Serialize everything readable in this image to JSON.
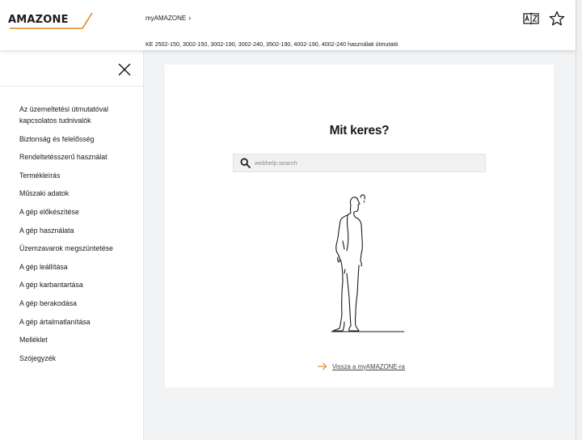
{
  "header": {
    "logo_text": "AMAZONE",
    "breadcrumb": "myAMAZONE",
    "breadcrumb_separator": "›",
    "subtitle": "KE 2502-150, 3002-150, 3002-190, 3002-240, 3502-190, 4002-190, 4002-240 használati útmutató",
    "icons": [
      "az-dictionary-icon",
      "star-icon"
    ]
  },
  "sidebar": {
    "close_icon": "close-icon",
    "items": [
      {
        "label": "Az üzemeltetési útmutatóval kapcsolatos tudnivalók"
      },
      {
        "label": "Biztonság és felelősség"
      },
      {
        "label": "Rendeltetésszerű használat"
      },
      {
        "label": "Termékleírás"
      },
      {
        "label": "Műszaki adatok"
      },
      {
        "label": "A gép előkészítése"
      },
      {
        "label": "A gép használata"
      },
      {
        "label": "Üzemzavarok megszüntetése"
      },
      {
        "label": "A gép leállítása"
      },
      {
        "label": "A gép karbantartása"
      },
      {
        "label": "A gép berakodása"
      },
      {
        "label": "A gép ártalmatlanítása"
      },
      {
        "label": "Melléklet"
      },
      {
        "label": "Szójegyzék"
      }
    ]
  },
  "main": {
    "title": "Mit keres?",
    "search": {
      "placeholder": "webhelp.search",
      "value": ""
    },
    "back_link": "Vissza a myAMAZONE-ra"
  },
  "colors": {
    "brand_orange": "#e8841a",
    "text": "#1a1a1a",
    "background": "#f2f3f5"
  }
}
